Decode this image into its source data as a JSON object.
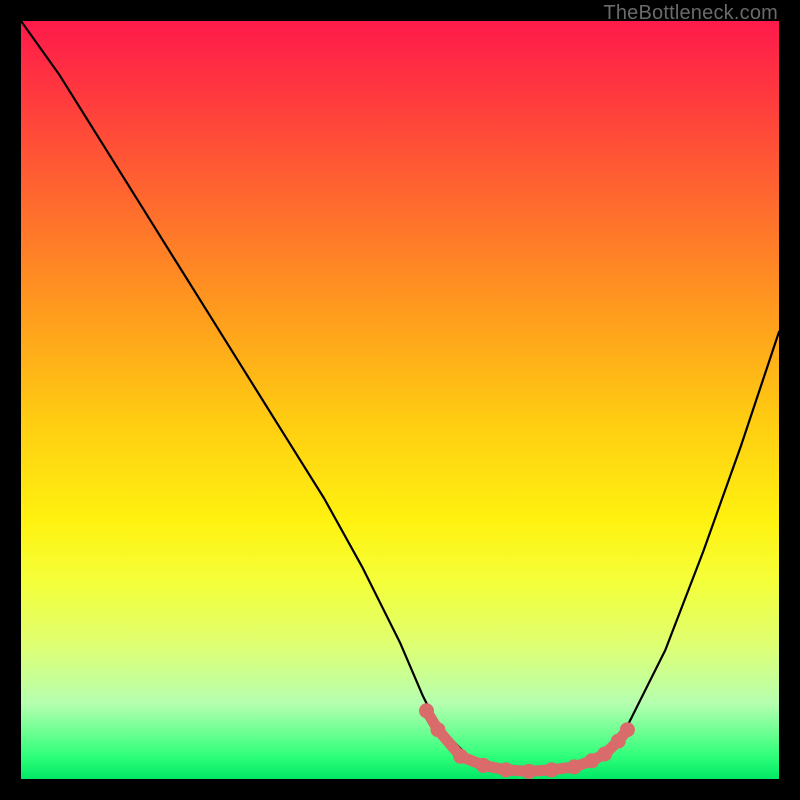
{
  "source": {
    "watermark": "TheBottleneck.com"
  },
  "chart_data": {
    "type": "line",
    "title": "",
    "xlabel": "",
    "ylabel": "",
    "xlim": [
      0,
      100
    ],
    "ylim": [
      0,
      100
    ],
    "grid": false,
    "legend": false,
    "background_gradient": {
      "direction": "vertical",
      "stops": [
        {
          "pos": 0,
          "color": "#ff1a4b"
        },
        {
          "pos": 50,
          "color": "#ffd400"
        },
        {
          "pos": 80,
          "color": "#f0ff50"
        },
        {
          "pos": 100,
          "color": "#00e765"
        }
      ]
    },
    "series": [
      {
        "name": "bottleneck-curve",
        "color": "#000000",
        "x": [
          0,
          5,
          10,
          15,
          20,
          25,
          30,
          35,
          40,
          45,
          50,
          53,
          55,
          58,
          60,
          63,
          66,
          70,
          73,
          76,
          80,
          85,
          90,
          95,
          100
        ],
        "y": [
          100,
          93,
          85,
          77,
          69,
          61,
          53,
          45,
          37,
          28,
          18,
          11,
          7,
          4,
          2,
          1.3,
          1.0,
          1.0,
          1.3,
          2.7,
          7,
          17,
          30,
          44,
          59
        ]
      }
    ],
    "highlight_region": {
      "name": "valley-markers",
      "color": "#d96b6b",
      "points": [
        {
          "x": 53.5,
          "y": 9.0
        },
        {
          "x": 55.0,
          "y": 6.5
        },
        {
          "x": 58.0,
          "y": 3.0
        },
        {
          "x": 61.0,
          "y": 1.8
        },
        {
          "x": 64.0,
          "y": 1.2
        },
        {
          "x": 67.0,
          "y": 1.0
        },
        {
          "x": 70.0,
          "y": 1.2
        },
        {
          "x": 73.0,
          "y": 1.6
        },
        {
          "x": 75.3,
          "y": 2.4
        },
        {
          "x": 77.0,
          "y": 3.3
        },
        {
          "x": 78.8,
          "y": 5.0
        },
        {
          "x": 80.0,
          "y": 6.5
        }
      ]
    }
  }
}
